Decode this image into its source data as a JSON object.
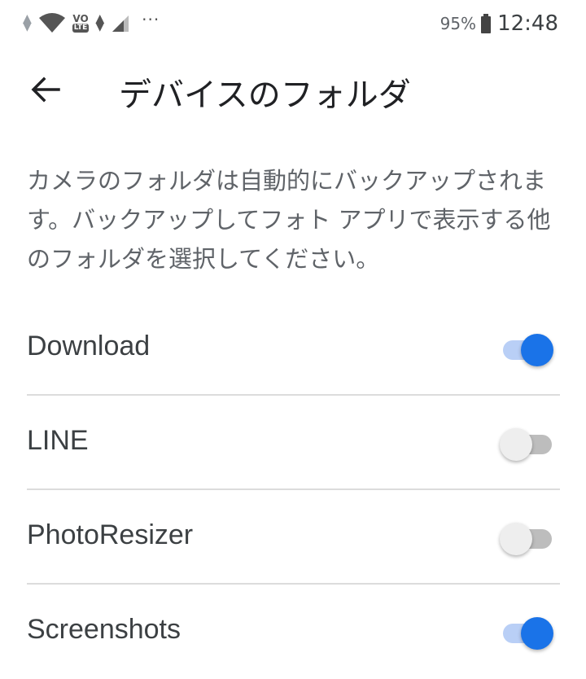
{
  "status_bar": {
    "volte_top": "VO",
    "volte_bottom": "LTE",
    "more": "···",
    "battery_percent": "95%",
    "time": "12:48"
  },
  "header": {
    "title": "デバイスのフォルダ",
    "back_icon": "arrow-back-icon"
  },
  "description": "カメラのフォルダは自動的にバックアップされます。バックアップしてフォト アプリで表示する他のフォルダを選択してください。",
  "folders": [
    {
      "name": "Download",
      "enabled": true
    },
    {
      "name": "LINE",
      "enabled": false
    },
    {
      "name": "PhotoResizer",
      "enabled": false
    },
    {
      "name": "Screenshots",
      "enabled": true
    }
  ],
  "colors": {
    "accent": "#1a73e8",
    "accent_track": "#b9cff6",
    "off_thumb": "#eeeeee",
    "off_track": "#bdbdbd"
  }
}
